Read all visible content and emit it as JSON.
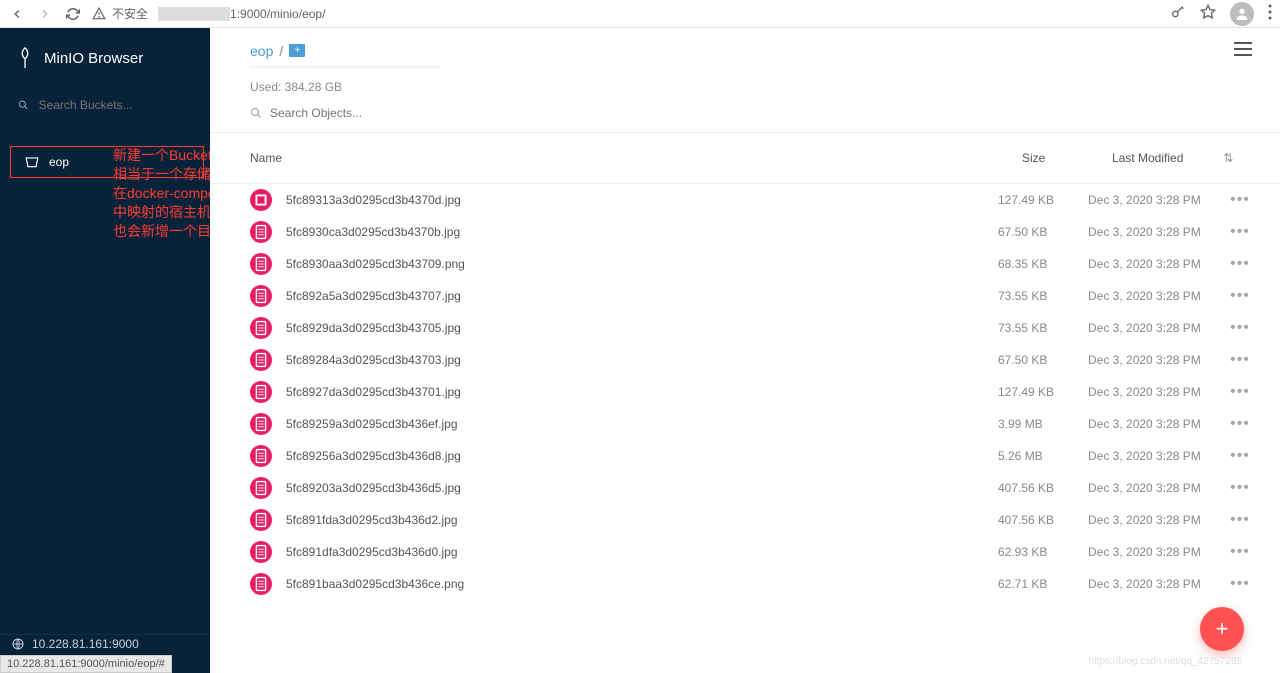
{
  "browser": {
    "security_label": "不安全",
    "url_suffix": "1:9000/minio/eop/",
    "status_url": "10.228.81.161:9000/minio/eop/#"
  },
  "sidebar": {
    "title": "MinIO Browser",
    "search_placeholder": "Search Buckets...",
    "buckets": [
      "eop"
    ],
    "footer_host": "10.228.81.161:9000"
  },
  "annotations": [
    "新建一个Buckets",
    "相当于一个存储库",
    "在docker-compose",
    "中映射的宿主机目录",
    "也会新增一个目录"
  ],
  "main": {
    "breadcrumb": "eop",
    "breadcrumb_sep": "/",
    "used_label": "Used: 384.28 GB",
    "search_placeholder": "Search Objects...",
    "columns": {
      "name": "Name",
      "size": "Size",
      "modified": "Last Modified"
    },
    "files": [
      {
        "name": "5fc89313a3d0295cd3b4370d.jpg",
        "size": "127.49 KB",
        "modified": "Dec 3, 2020 3:28 PM"
      },
      {
        "name": "5fc8930ca3d0295cd3b4370b.jpg",
        "size": "67.50 KB",
        "modified": "Dec 3, 2020 3:28 PM"
      },
      {
        "name": "5fc8930aa3d0295cd3b43709.png",
        "size": "68.35 KB",
        "modified": "Dec 3, 2020 3:28 PM"
      },
      {
        "name": "5fc892a5a3d0295cd3b43707.jpg",
        "size": "73.55 KB",
        "modified": "Dec 3, 2020 3:28 PM"
      },
      {
        "name": "5fc8929da3d0295cd3b43705.jpg",
        "size": "73.55 KB",
        "modified": "Dec 3, 2020 3:28 PM"
      },
      {
        "name": "5fc89284a3d0295cd3b43703.jpg",
        "size": "67.50 KB",
        "modified": "Dec 3, 2020 3:28 PM"
      },
      {
        "name": "5fc8927da3d0295cd3b43701.jpg",
        "size": "127.49 KB",
        "modified": "Dec 3, 2020 3:28 PM"
      },
      {
        "name": "5fc89259a3d0295cd3b436ef.jpg",
        "size": "3.99 MB",
        "modified": "Dec 3, 2020 3:28 PM"
      },
      {
        "name": "5fc89256a3d0295cd3b436d8.jpg",
        "size": "5.26 MB",
        "modified": "Dec 3, 2020 3:28 PM"
      },
      {
        "name": "5fc89203a3d0295cd3b436d5.jpg",
        "size": "407.56 KB",
        "modified": "Dec 3, 2020 3:28 PM"
      },
      {
        "name": "5fc891fda3d0295cd3b436d2.jpg",
        "size": "407.56 KB",
        "modified": "Dec 3, 2020 3:28 PM"
      },
      {
        "name": "5fc891dfa3d0295cd3b436d0.jpg",
        "size": "62.93 KB",
        "modified": "Dec 3, 2020 3:28 PM"
      },
      {
        "name": "5fc891baa3d0295cd3b436ce.png",
        "size": "62.71 KB",
        "modified": "Dec 3, 2020 3:28 PM"
      }
    ]
  }
}
